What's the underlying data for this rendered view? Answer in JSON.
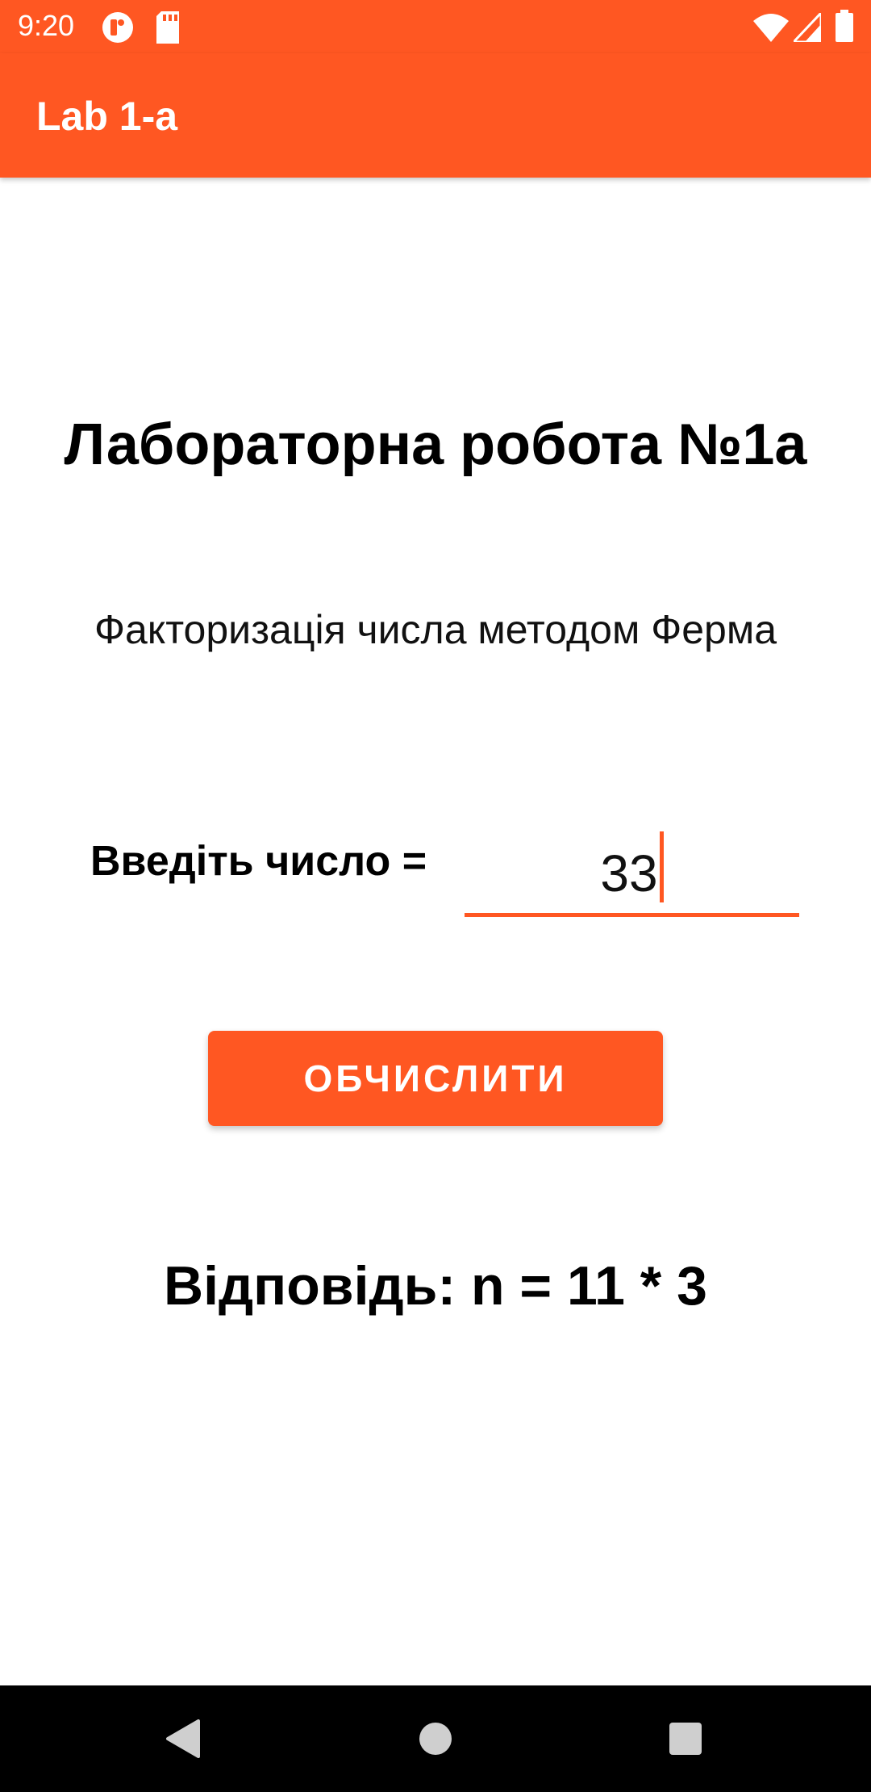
{
  "status_bar": {
    "time": "9:20",
    "left_icons": [
      "notification-circle-icon",
      "sd-card-icon"
    ],
    "right_icons": [
      "wifi-icon",
      "signal-icon",
      "battery-icon"
    ]
  },
  "app_bar": {
    "title": "Lab 1-a"
  },
  "main": {
    "heading": "Лабораторна робота №1а",
    "subtitle": "Факторизація числа методом Ферма",
    "input_label": "Введіть число =",
    "input_value": "33",
    "button_label": "ОБЧИСЛИТИ",
    "answer": "Відповідь: n = 11 * 3"
  },
  "nav_bar": {
    "buttons": [
      "back-icon",
      "home-icon",
      "recents-icon"
    ]
  },
  "colors": {
    "accent": "#FF5722",
    "text": "#000000",
    "nav_background": "#000000",
    "nav_icons": "#cfcfcf"
  }
}
